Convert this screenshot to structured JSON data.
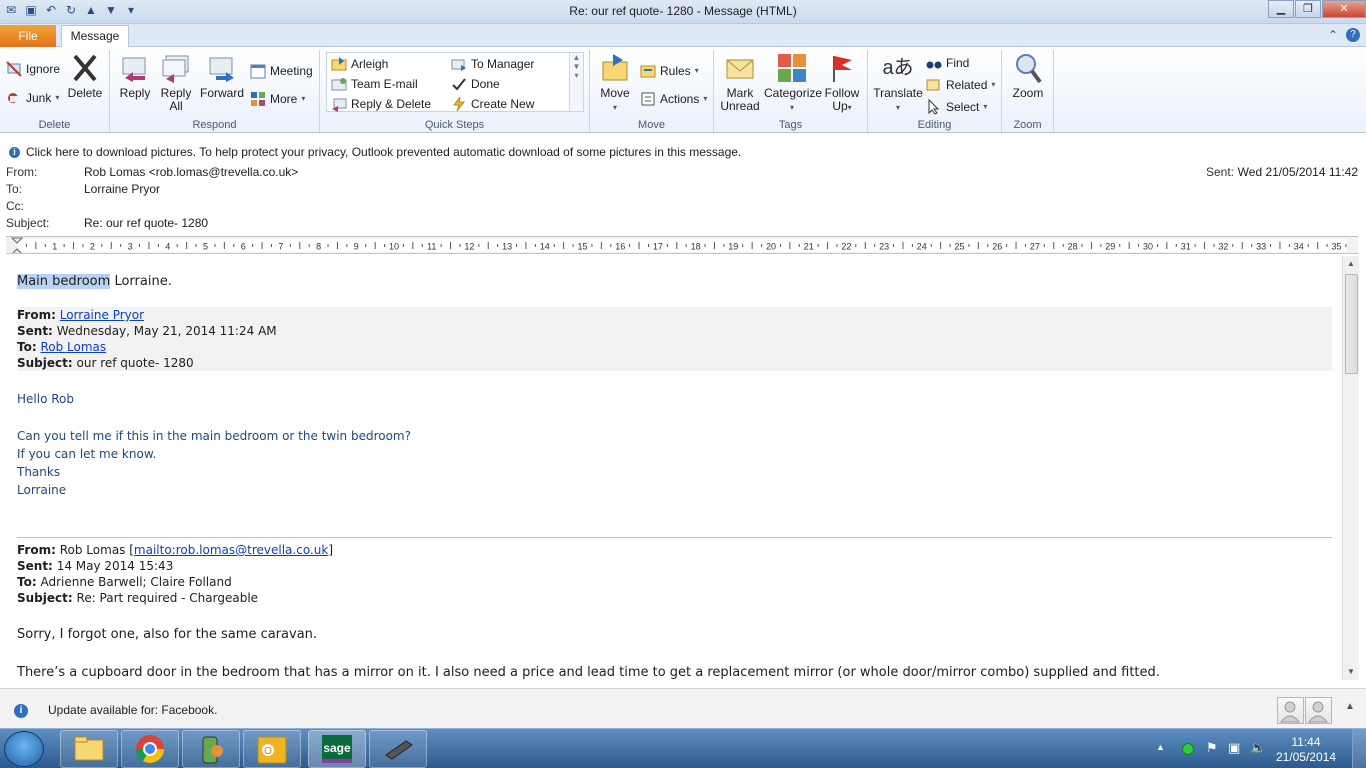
{
  "window": {
    "title": "Re: our ref quote- 1280  -  Message (HTML)",
    "close_glyph": "✕",
    "minimize_glyph": "▁",
    "maximize_glyph": "❐"
  },
  "tabs": {
    "file": "File",
    "message": "Message"
  },
  "ribbon": {
    "delete_group": {
      "label": "Delete",
      "ignore": "Ignore",
      "junk": "Junk",
      "delete": "Delete"
    },
    "respond_group": {
      "label": "Respond",
      "reply": "Reply",
      "reply_all_1": "Reply",
      "reply_all_2": "All",
      "forward": "Forward",
      "meeting": "Meeting",
      "more": "More"
    },
    "quicksteps_group": {
      "label": "Quick Steps",
      "items": [
        "Arleigh",
        "To Manager",
        "Team E-mail",
        "Done",
        "Reply & Delete",
        "Create New"
      ]
    },
    "move_group": {
      "label": "Move",
      "move": "Move",
      "rules": "Rules",
      "actions": "Actions"
    },
    "tags_group": {
      "label": "Tags",
      "mark_unread_1": "Mark",
      "mark_unread_2": "Unread",
      "categorize": "Categorize",
      "follow_up_1": "Follow",
      "follow_up_2": "Up"
    },
    "editing_group": {
      "label": "Editing",
      "translate": "Translate",
      "find": "Find",
      "related": "Related",
      "select": "Select"
    },
    "zoom_group": {
      "label": "Zoom",
      "zoom": "Zoom"
    }
  },
  "infobar": {
    "text": "Click here to download pictures. To help protect your privacy, Outlook prevented automatic download of some pictures in this message."
  },
  "header": {
    "from_label": "From:",
    "from_value": "Rob Lomas <rob.lomas@trevella.co.uk>",
    "to_label": "To:",
    "to_value": "Lorraine Pryor",
    "cc_label": "Cc:",
    "subject_label": "Subject:",
    "subject_value": "Re: our ref quote- 1280",
    "sent_label": "Sent:",
    "sent_value": "Wed 21/05/2014 11:42"
  },
  "ruler": {
    "numbers": [
      "1",
      "2",
      "3",
      "4",
      "5",
      "6",
      "7",
      "8",
      "9",
      "10",
      "11",
      "12",
      "13",
      "14",
      "15",
      "16",
      "17",
      "18",
      "19",
      "20",
      "21",
      "22",
      "23",
      "24",
      "25",
      "26",
      "27",
      "28",
      "29",
      "30",
      "31",
      "32",
      "33",
      "34",
      "35"
    ]
  },
  "body": {
    "reply_selected": "Main bedroom",
    "reply_rest": " Lorraine.",
    "q1_from_label": "From:",
    "q1_from": "Lorraine Pryor",
    "q1_sent_label": "Sent:",
    "q1_sent": "Wednesday, May 21, 2014 11:24 AM",
    "q1_to_label": "To:",
    "q1_to": "Rob Lomas",
    "q1_subject_label": "Subject:",
    "q1_subject": "our ref quote- 1280",
    "hello": "Hello Rob",
    "question": "Can you tell me if this in the main bedroom or the twin bedroom?",
    "let_me_know": "If you can let me know.",
    "thanks": "Thanks",
    "signature": "Lorraine",
    "q2_from_label": "From:",
    "q2_from": "Rob Lomas [",
    "q2_from_link": "mailto:rob.lomas@trevella.co.uk",
    "q2_from_end": "]",
    "q2_sent_label": "Sent:",
    "q2_sent": "14 May 2014 15:43",
    "q2_to_label": "To:",
    "q2_to": "Adrienne Barwell; Claire Folland",
    "q2_subject_label": "Subject:",
    "q2_subject": "Re: Part required - Chargeable",
    "sorry": "Sorry, I forgot one, also for the same caravan.",
    "cupboard": "There’s a cupboard door in the bedroom that has a mirror on it. I also need a price and lead time to get a replacement mirror (or whole door/mirror combo) supplied and fitted."
  },
  "statusbar": {
    "text": "Update available for: Facebook."
  },
  "taskbar": {
    "time": "11:44",
    "date": "21/05/2014",
    "apps": [
      "explorer-icon",
      "chrome-icon",
      "phone-app-icon",
      "outlook-icon",
      "sage-icon",
      "stapler-app-icon"
    ],
    "sage_label": "sage"
  },
  "colors": {
    "file_tab": "#e2731a",
    "quoted_text": "#1f497d",
    "link": "#0b3ec4",
    "selection": "#b7d2f2"
  }
}
